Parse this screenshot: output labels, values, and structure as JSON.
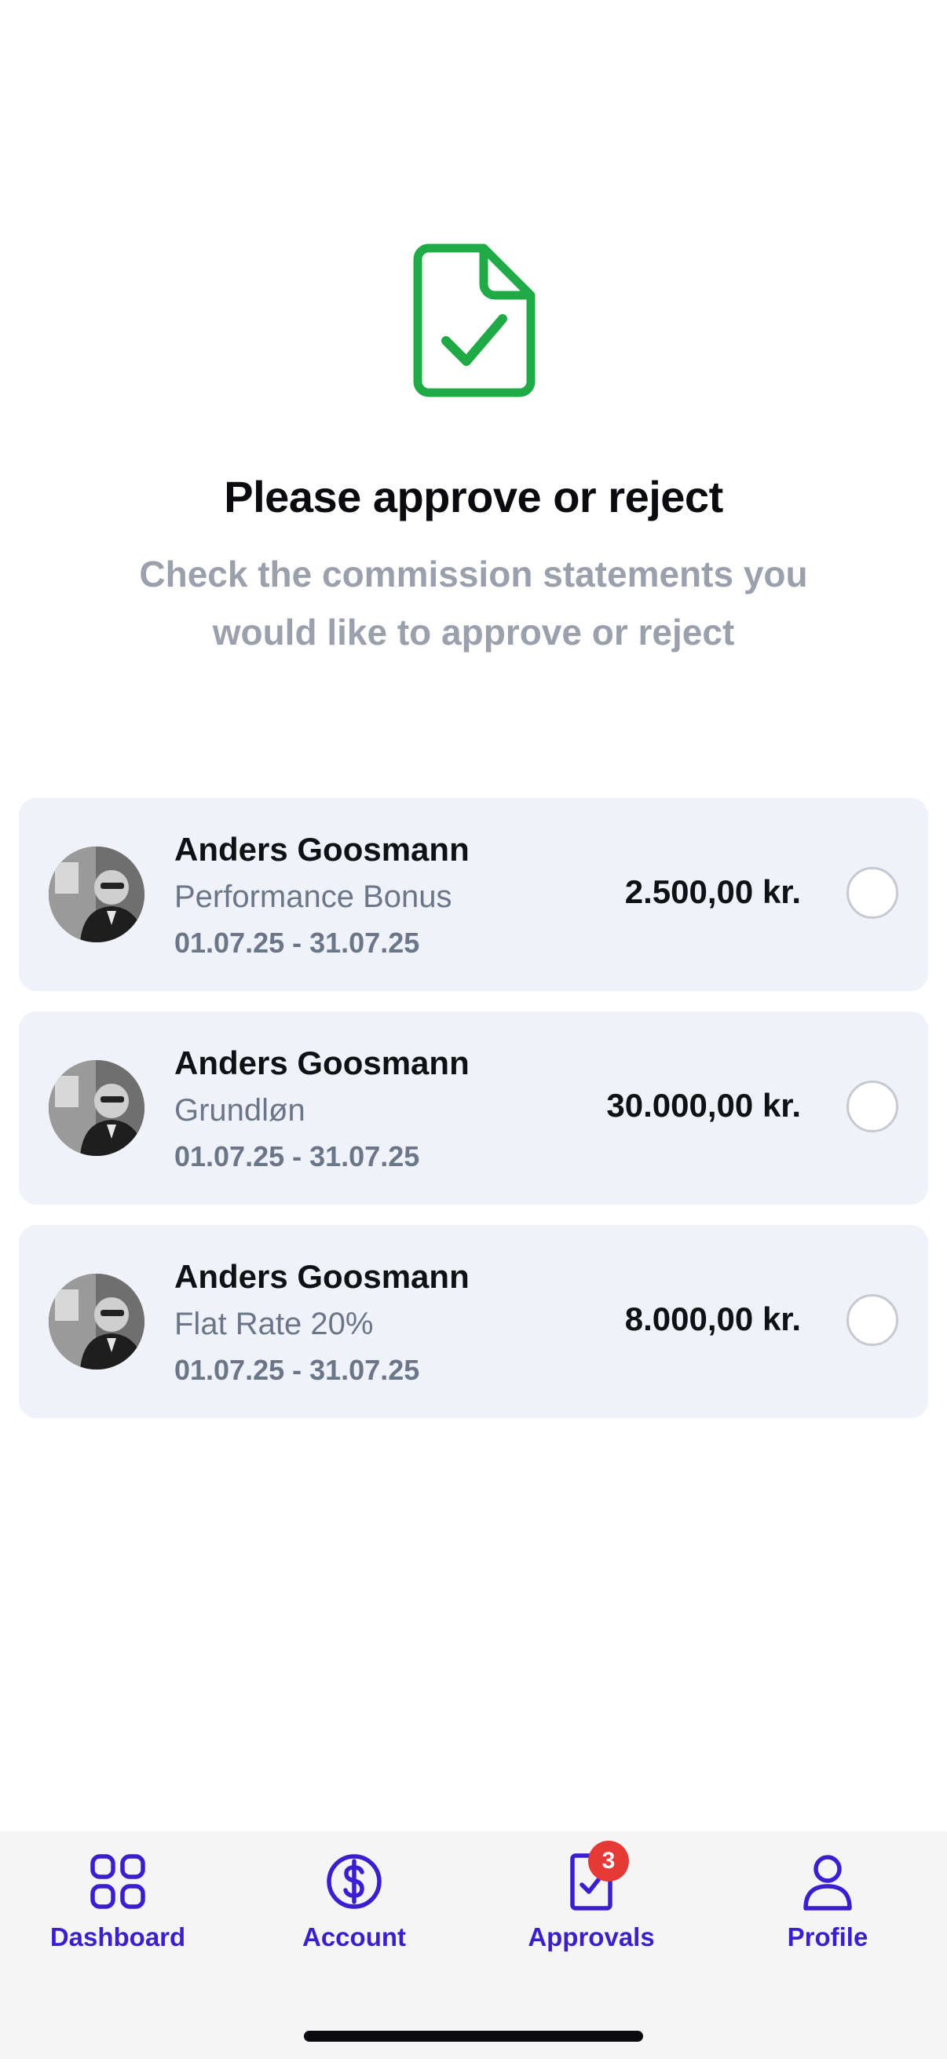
{
  "header": {
    "icon": "document-check-icon",
    "icon_color": "#1faa45",
    "title": "Please approve or reject",
    "subtitle": "Check the commission statements you would like to approve or reject"
  },
  "statements": [
    {
      "name": "Anders Goosmann",
      "type": "Performance Bonus",
      "period": "01.07.25 - 31.07.25",
      "amount": "2.500,00 kr.",
      "selected": false
    },
    {
      "name": "Anders Goosmann",
      "type": "Grundløn",
      "period": "01.07.25 - 31.07.25",
      "amount": "30.000,00 kr.",
      "selected": false
    },
    {
      "name": "Anders Goosmann",
      "type": "Flat Rate 20%",
      "period": "01.07.25 - 31.07.25",
      "amount": "8.000,00 kr.",
      "selected": false
    }
  ],
  "tabbar": {
    "accent_color": "#3a1fcf",
    "tabs": [
      {
        "label": "Dashboard",
        "icon": "grid-icon"
      },
      {
        "label": "Account",
        "icon": "dollar-circle-icon"
      },
      {
        "label": "Approvals",
        "icon": "document-check-icon",
        "badge": "3"
      },
      {
        "label": "Profile",
        "icon": "person-icon"
      }
    ]
  }
}
